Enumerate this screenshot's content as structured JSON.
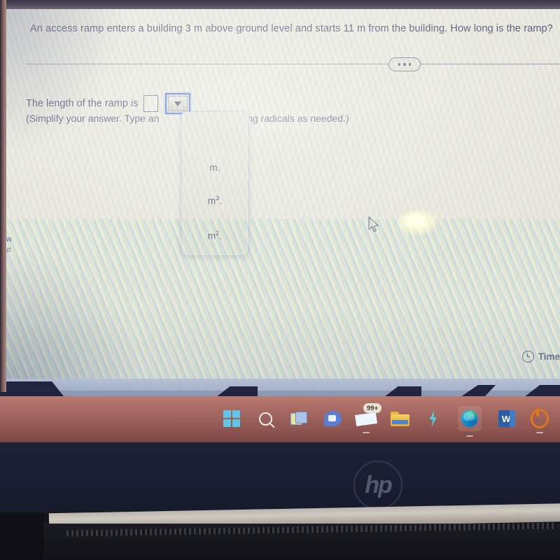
{
  "device": {
    "brand_logo": "hp",
    "device_type": "laptop"
  },
  "question": {
    "text": "An access ramp enters a building 3 m above ground level and starts 11 m from the building. How long is the ramp?",
    "more_options_label": "•••"
  },
  "answer": {
    "prompt": "The length of the ramp is",
    "input_value": "",
    "hint_left": "(Simplify your answer. Type an",
    "hint_right": "using radicals as needed.)"
  },
  "unit_dropdown": {
    "expanded": true,
    "selected": "",
    "options": [
      {
        "label": "m.",
        "base": "m",
        "exponent": "",
        "suffix": "."
      },
      {
        "label": "m3.",
        "base": "m",
        "exponent": "3",
        "suffix": "."
      },
      {
        "label": "m2.",
        "base": "m",
        "exponent": "2",
        "suffix": "."
      }
    ]
  },
  "timer": {
    "icon": "clock-icon",
    "label": "Time"
  },
  "edge_nav": {
    "line1": "w",
    "line2": "#"
  },
  "taskbar": {
    "background_color": "#9d5b57",
    "items": [
      {
        "name": "start-button",
        "icon": "windows-logo-icon",
        "label": "Start",
        "badge": "",
        "running": false
      },
      {
        "name": "search-button",
        "icon": "search-icon",
        "label": "Search",
        "badge": "",
        "running": false
      },
      {
        "name": "task-view-button",
        "icon": "task-view-icon",
        "label": "Task View",
        "badge": "",
        "running": false
      },
      {
        "name": "teams-button",
        "icon": "teams-chat-icon",
        "label": "Chat",
        "badge": "",
        "running": false
      },
      {
        "name": "mail-button",
        "icon": "mail-icon",
        "label": "Mail",
        "badge": "99+",
        "running": true
      },
      {
        "name": "file-explorer-button",
        "icon": "folder-icon",
        "label": "File Explorer",
        "badge": "",
        "running": false
      },
      {
        "name": "lightning-app-button",
        "icon": "lightning-bolt-icon",
        "label": "",
        "badge": "",
        "running": false
      },
      {
        "name": "edge-button",
        "icon": "edge-browser-icon",
        "label": "Microsoft Edge",
        "badge": "",
        "running": true
      },
      {
        "name": "word-button",
        "icon": "word-icon",
        "label": "Word",
        "badge": "",
        "running": false
      },
      {
        "name": "orange-app-button",
        "icon": "orange-circle-icon",
        "label": "",
        "badge": "",
        "running": true
      }
    ]
  },
  "colors": {
    "screen_bg": "#e9e7dc",
    "text": "#3b3a63",
    "focus_border": "#2b54d8",
    "taskbar": "#9d5b57",
    "bezel": "#1a1e31"
  }
}
